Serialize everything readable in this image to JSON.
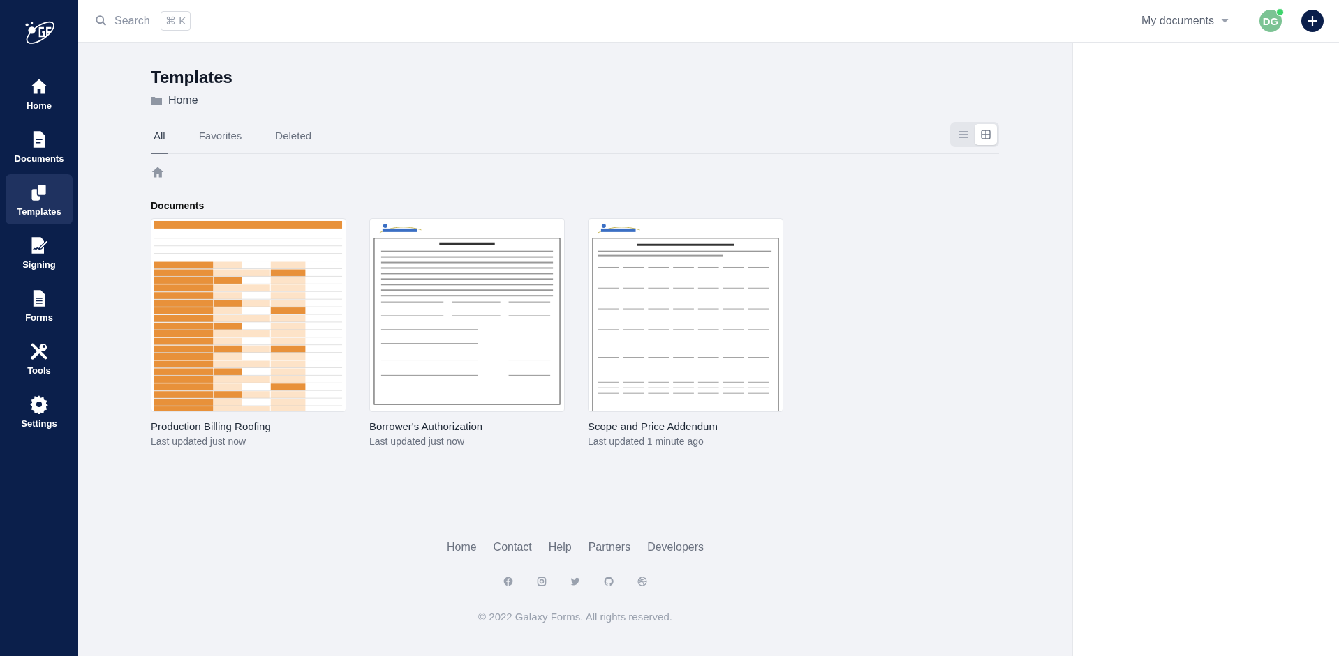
{
  "sidebar": {
    "items": [
      {
        "label": "Home",
        "selected": false
      },
      {
        "label": "Documents",
        "selected": false
      },
      {
        "label": "Templates",
        "selected": true
      },
      {
        "label": "Signing",
        "selected": false
      },
      {
        "label": "Forms",
        "selected": false
      },
      {
        "label": "Tools",
        "selected": false
      },
      {
        "label": "Settings",
        "selected": false
      }
    ]
  },
  "header": {
    "search": {
      "placeholder": "Search",
      "shortcut": "⌘ K"
    },
    "scope_menu": "My documents",
    "avatar": {
      "initials": "DG",
      "online": true
    }
  },
  "page": {
    "title": "Templates",
    "folder": "Home",
    "tabs": [
      {
        "label": "All",
        "selected": true
      },
      {
        "label": "Favorites",
        "selected": false
      },
      {
        "label": "Deleted",
        "selected": false
      }
    ],
    "view_toggle": [
      {
        "selected": false
      },
      {
        "selected": true
      }
    ],
    "section_title": "Documents",
    "documents": [
      {
        "kind": "spreadsheet",
        "name": "Production Billing Roofing",
        "updated": "Last updated just now"
      },
      {
        "kind": "letter",
        "name": "Borrower's Authorization",
        "updated": "Last updated just now"
      },
      {
        "kind": "form",
        "name": "Scope and Price Addendum",
        "updated": "Last updated 1 minute ago"
      }
    ]
  },
  "footer": {
    "links": [
      "Home",
      "Contact",
      "Help",
      "Partners",
      "Developers"
    ],
    "copyright": "© 2022 Galaxy Forms. All rights reserved."
  }
}
